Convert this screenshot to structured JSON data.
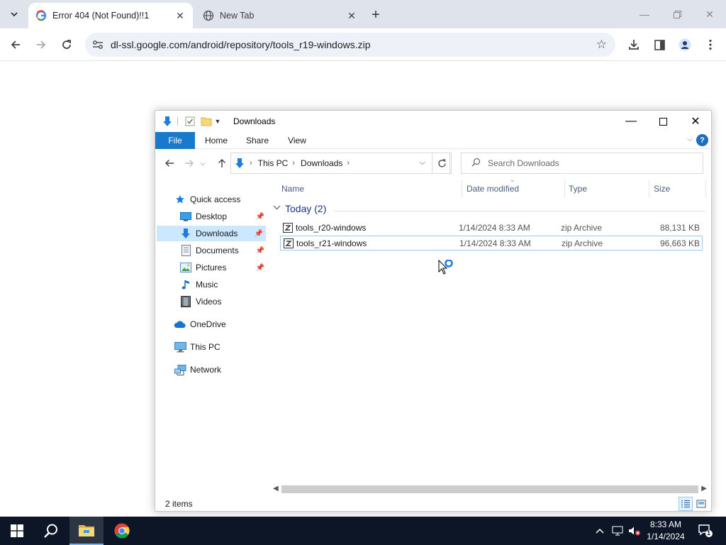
{
  "browser": {
    "tabs": [
      {
        "title": "Error 404 (Not Found)!!1",
        "active": true
      },
      {
        "title": "New Tab",
        "active": false
      }
    ],
    "url": "dl-ssl.google.com/android/repository/tools_r19-windows.zip"
  },
  "explorer": {
    "title": "Downloads",
    "ribbon_tabs": [
      "File",
      "Home",
      "Share",
      "View"
    ],
    "breadcrumb": [
      "This PC",
      "Downloads"
    ],
    "search_placeholder": "Search Downloads",
    "nav_items": [
      {
        "label": "Quick access",
        "icon": "star-icon",
        "pinned": false
      },
      {
        "label": "Desktop",
        "icon": "desktop-icon",
        "pinned": true
      },
      {
        "label": "Downloads",
        "icon": "download-arrow-icon",
        "pinned": true,
        "selected": true
      },
      {
        "label": "Documents",
        "icon": "document-icon",
        "pinned": true
      },
      {
        "label": "Pictures",
        "icon": "picture-icon",
        "pinned": true
      },
      {
        "label": "Music",
        "icon": "music-note-icon",
        "pinned": false
      },
      {
        "label": "Videos",
        "icon": "film-icon",
        "pinned": false
      },
      {
        "label": "OneDrive",
        "icon": "cloud-icon",
        "pinned": false
      },
      {
        "label": "This PC",
        "icon": "computer-icon",
        "pinned": false
      },
      {
        "label": "Network",
        "icon": "network-icon",
        "pinned": false
      }
    ],
    "columns": [
      "Name",
      "Date modified",
      "Type",
      "Size"
    ],
    "group_label": "Today (2)",
    "files": [
      {
        "name": "tools_r20-windows",
        "date": "1/14/2024 8:33 AM",
        "type": "zip Archive",
        "size": "88,131 KB"
      },
      {
        "name": "tools_r21-windows",
        "date": "1/14/2024 8:33 AM",
        "type": "zip Archive",
        "size": "96,663 KB"
      }
    ],
    "status": "2 items"
  },
  "taskbar": {
    "time": "8:33 AM",
    "date": "1/14/2024",
    "notification_count": "1"
  },
  "colors": {
    "ribbon_file": "#1979ca",
    "selection": "#cce8ff",
    "taskbar": "#0d1626"
  }
}
